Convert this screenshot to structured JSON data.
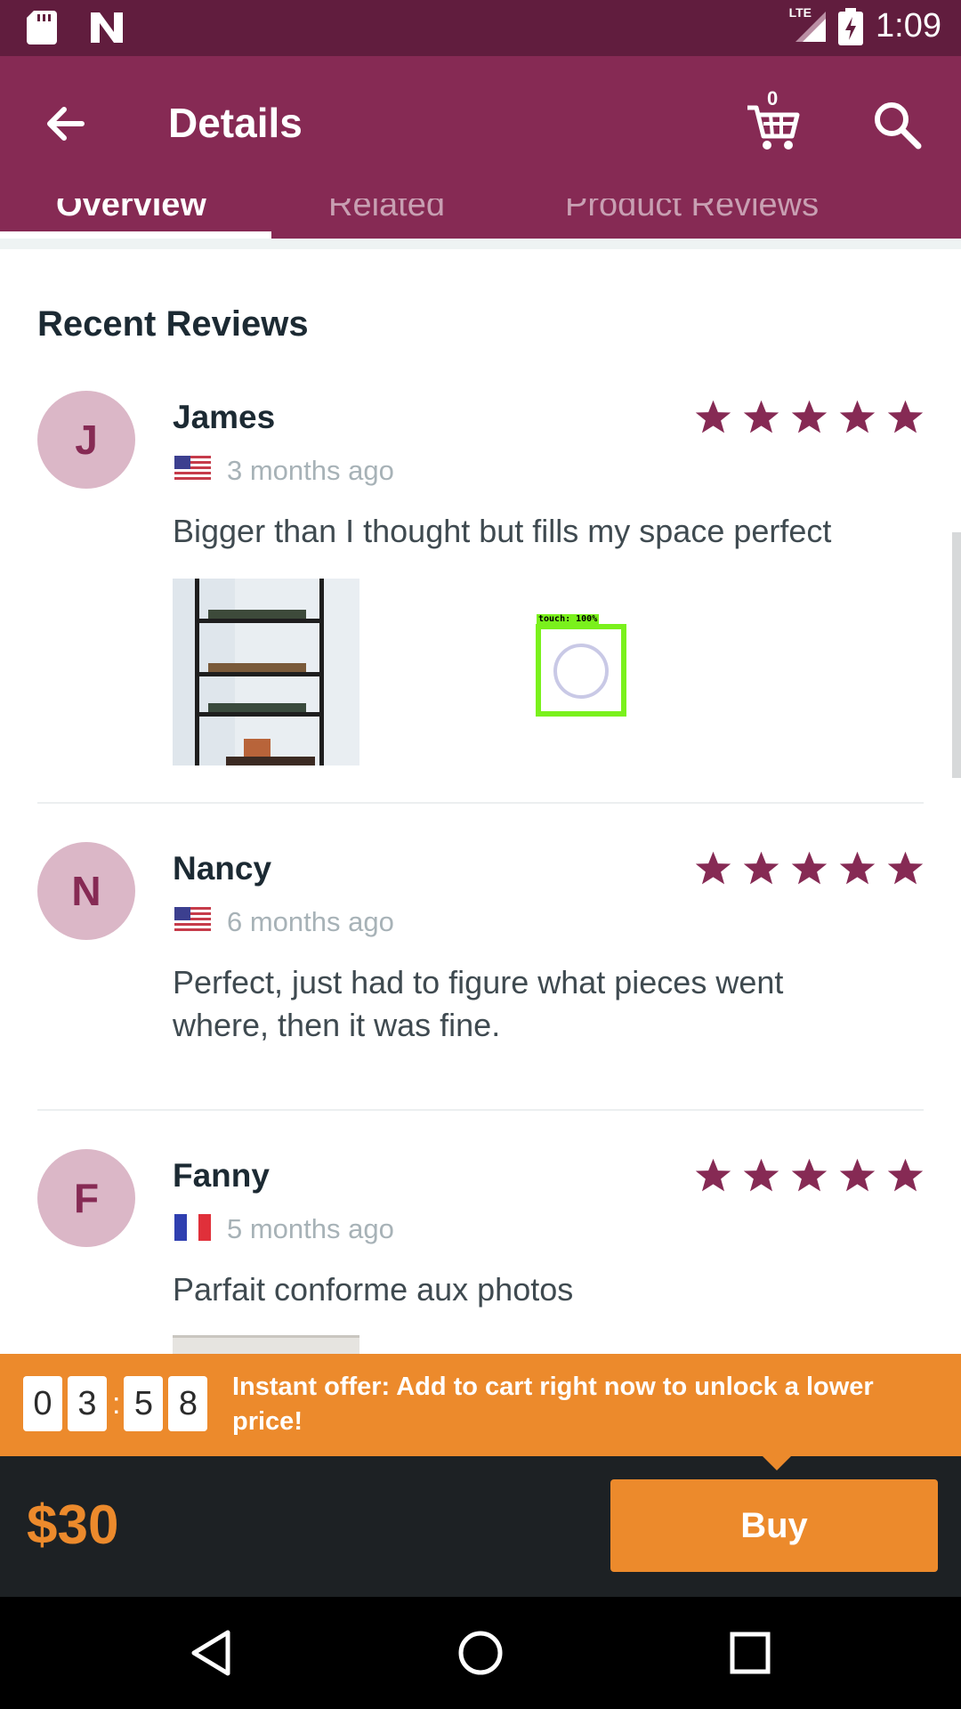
{
  "status_bar": {
    "time": "1:09",
    "network": "LTE"
  },
  "app_bar": {
    "title": "Details",
    "cart_count": "0"
  },
  "tabs": [
    {
      "label": "Overview",
      "active": true
    },
    {
      "label": "Related",
      "active": false
    },
    {
      "label": "Product Reviews",
      "active": false
    }
  ],
  "reviews_section": {
    "title": "Recent Reviews",
    "reviews": [
      {
        "initial": "J",
        "name": "James",
        "country": "US",
        "date": "3 months ago",
        "rating": 5,
        "text": "Bigger than I thought but fills my space perfect",
        "has_photo": true
      },
      {
        "initial": "N",
        "name": "Nancy",
        "country": "US",
        "date": "6 months ago",
        "rating": 5,
        "text": "Perfect, just had to figure what pieces went where, then it was fine.",
        "has_photo": false
      },
      {
        "initial": "F",
        "name": "Fanny",
        "country": "FR",
        "date": "5 months ago",
        "rating": 5,
        "text": "Parfait conforme aux photos",
        "has_photo": true
      }
    ]
  },
  "touch_overlay": {
    "label": "touch: 100%"
  },
  "offer": {
    "timer_digits": [
      "0",
      "3",
      "5",
      "8"
    ],
    "text": "Instant offer: Add to cart right now to unlock a lower price!"
  },
  "purchase": {
    "price": "$30",
    "buy_label": "Buy"
  },
  "colors": {
    "primary": "#862a54",
    "status_bar": "#611d3e",
    "accent": "#ec8a2c",
    "star": "#862a54"
  }
}
